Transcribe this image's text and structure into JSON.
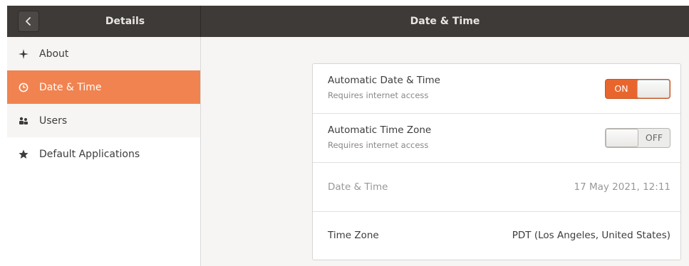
{
  "header": {
    "left_title": "Details",
    "title": "Date & Time",
    "back_icon": "chevron-left-icon"
  },
  "sidebar": {
    "items": [
      {
        "label": "About",
        "icon": "sparkle-icon",
        "active": false
      },
      {
        "label": "Date & Time",
        "icon": "clock-icon",
        "active": true
      },
      {
        "label": "Users",
        "icon": "users-icon",
        "active": false
      },
      {
        "label": "Default Applications",
        "icon": "star-icon",
        "active": false
      }
    ]
  },
  "settings": {
    "automatic_date_time": {
      "title": "Automatic Date & Time",
      "subtitle": "Requires internet access",
      "state": "ON"
    },
    "automatic_time_zone": {
      "title": "Automatic Time Zone",
      "subtitle": "Requires internet access",
      "state": "OFF"
    },
    "date_time": {
      "title": "Date & Time",
      "value": "17 May 2021, 12:11"
    },
    "time_zone": {
      "title": "Time Zone",
      "value": "PDT (Los Angeles, United States)"
    }
  },
  "colors": {
    "accent": "#f08350",
    "switch_on": "#e8662e",
    "header": "#3d3a37"
  }
}
